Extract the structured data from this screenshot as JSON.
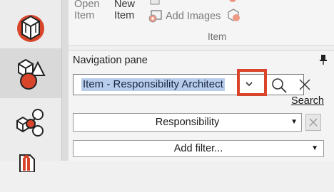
{
  "ribbon": {
    "open_item_line1": "Open",
    "open_item_line2": "Item",
    "new_item_line1": "New",
    "new_item_line2": "Item",
    "add_images": "Add Images",
    "group_label": "Item"
  },
  "rail": {
    "items": [
      {
        "icon": "item-structure-icon"
      },
      {
        "icon": "shapes-icon",
        "active": true
      },
      {
        "icon": "relationship-icon"
      },
      {
        "icon": "document-icon"
      }
    ]
  },
  "navpane": {
    "title": "Navigation pane",
    "search_value": "Item - Responsibility Architect",
    "search_link": "Search",
    "responsibility_value": "Responsibility",
    "add_filter_label": "Add filter...",
    "highlight_color": "#d9452b"
  }
}
